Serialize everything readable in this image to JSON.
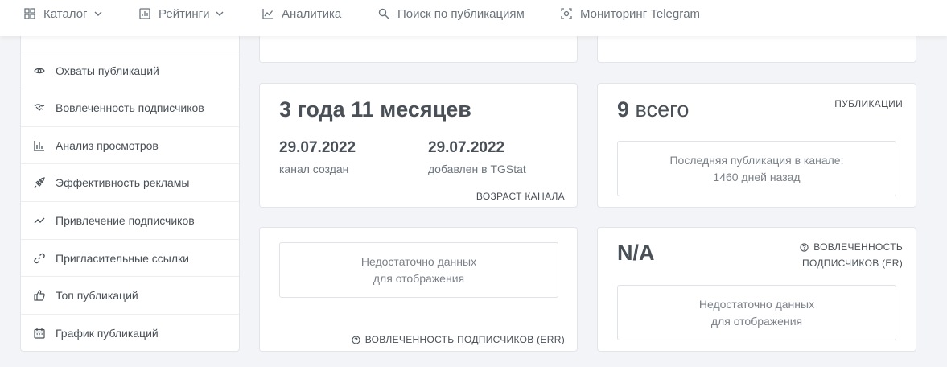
{
  "nav": {
    "items": [
      {
        "label": "Каталог",
        "icon": "grid-icon",
        "has_dropdown": true
      },
      {
        "label": "Рейтинги",
        "icon": "bar-chart-icon",
        "has_dropdown": true
      },
      {
        "label": "Аналитика",
        "icon": "line-chart-icon",
        "has_dropdown": false
      },
      {
        "label": "Поиск по публикациям",
        "icon": "search-icon",
        "has_dropdown": false
      },
      {
        "label": "Мониторинг Telegram",
        "icon": "monitor-scan-icon",
        "has_dropdown": false
      }
    ]
  },
  "sidebar": {
    "items": [
      {
        "label": "Охваты публикаций",
        "icon": "eye-icon"
      },
      {
        "label": "Вовлеченность подписчиков",
        "icon": "handshake-icon"
      },
      {
        "label": "Анализ просмотров",
        "icon": "bar-chart-icon"
      },
      {
        "label": "Эффективность рекламы",
        "icon": "rocket-icon"
      },
      {
        "label": "Привлечение подписчиков",
        "icon": "trend-icon"
      },
      {
        "label": "Пригласительные ссылки",
        "icon": "link-icon"
      },
      {
        "label": "Топ публикаций",
        "icon": "thumbs-up-icon"
      },
      {
        "label": "График публикаций",
        "icon": "calendar-icon"
      }
    ]
  },
  "age_card": {
    "title": "3 года 11 месяцев",
    "created_date": "29.07.2022",
    "created_label": "канал создан",
    "added_date": "29.07.2022",
    "added_label": "добавлен в TGStat",
    "caption": "ВОЗРАСТ КАНАЛА"
  },
  "posts_card": {
    "count": "9",
    "count_suffix": "всего",
    "caption": "ПУБЛИКАЦИИ",
    "last_post_line1": "Последняя публикация в канале:",
    "last_post_line2": "1460 дней назад"
  },
  "err_card": {
    "no_data_line1": "Недостаточно данных",
    "no_data_line2": "для отображения",
    "caption": "ВОВЛЕЧЕННОСТЬ ПОДПИСЧИКОВ (ERR)"
  },
  "er_card": {
    "value": "N/A",
    "caption_line1": "ВОВЛЕЧЕННОСТЬ",
    "caption_line2": "ПОДПИСЧИКОВ (ER)",
    "no_data_line1": "Недостаточно данных",
    "no_data_line2": "для отображения"
  },
  "colors": {
    "background": "#f3f4f7",
    "card": "#ffffff",
    "text": "#495057",
    "muted": "#6c757d"
  }
}
